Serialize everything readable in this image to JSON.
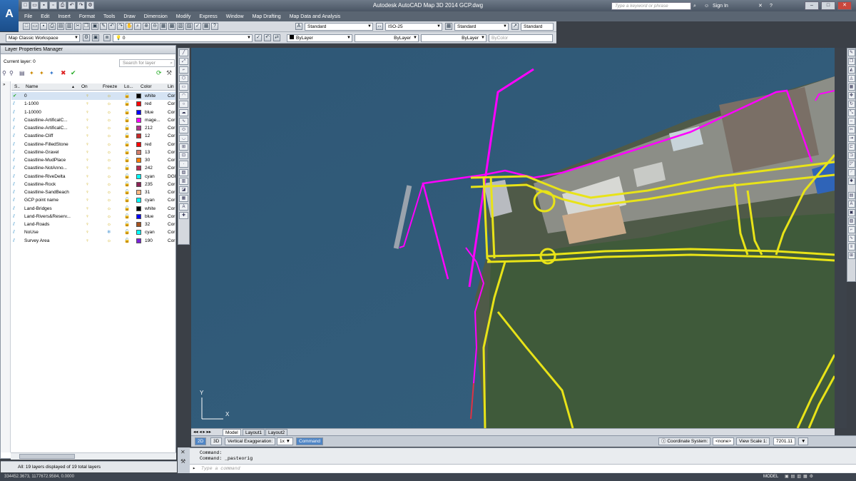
{
  "app": {
    "logo": "A",
    "title": "Autodesk AutoCAD Map 3D 2014   GCP.dwg",
    "search_placeholder": "Type a keyword or phrase",
    "sign_in": "Sign In"
  },
  "menus": [
    "File",
    "Edit",
    "Insert",
    "Format",
    "Tools",
    "Draw",
    "Dimension",
    "Modify",
    "Express",
    "Window",
    "Map Drafting",
    "Map Data and Analysis"
  ],
  "styles_toolbar": {
    "text_style": "Standard",
    "dim_style": "ISO-25",
    "table_style": "Standard",
    "mleader_style": "Standard"
  },
  "props_toolbar": {
    "workspace": "Map Classic Workspace",
    "current_layer": "0",
    "color": "ByLayer",
    "linetype": "ByLayer",
    "lineweight": "ByLayer",
    "plotstyle": "ByColor"
  },
  "layer_panel": {
    "title": "Layer Properties Manager",
    "current_layer_label": "Current layer: 0",
    "search_placeholder": "Search for layer",
    "columns": {
      "status": "S..",
      "name": "Name",
      "on": "On",
      "freeze": "Freeze",
      "lock": "Lo...",
      "color": "Color",
      "linetype": "Lin"
    },
    "status_text": "All: 19 layers displayed of 19 total layers",
    "layers": [
      {
        "name": "0",
        "color_name": "white",
        "hex": "#000000",
        "lt": "Cor",
        "frozen": false
      },
      {
        "name": "1-1000",
        "color_name": "red",
        "hex": "#ff0000",
        "lt": "Cor",
        "frozen": false
      },
      {
        "name": "1-10000",
        "color_name": "blue",
        "hex": "#0000ff",
        "lt": "Cor",
        "frozen": false
      },
      {
        "name": "Coastline-ArtificalC...",
        "color_name": "mage...",
        "hex": "#ff00ff",
        "lt": "Cor",
        "frozen": false
      },
      {
        "name": "Coastline-ArtificalC...",
        "color_name": "212",
        "hex": "#b0338f",
        "lt": "Cor",
        "frozen": false
      },
      {
        "name": "Coastline-Cliff",
        "color_name": "12",
        "hex": "#c82a2a",
        "lt": "Cor",
        "frozen": false
      },
      {
        "name": "Coastline-FilledStone",
        "color_name": "red",
        "hex": "#ff0000",
        "lt": "Cor",
        "frozen": false
      },
      {
        "name": "Coastline-Gravel",
        "color_name": "13",
        "hex": "#d27d6a",
        "lt": "Cor",
        "frozen": false
      },
      {
        "name": "Coastline-MudPlace",
        "color_name": "30",
        "hex": "#ff7f00",
        "lt": "Cor",
        "frozen": false
      },
      {
        "name": "Coastline-NotAnno...",
        "color_name": "242",
        "hex": "#b52a52",
        "lt": "Cor",
        "frozen": false
      },
      {
        "name": "Coastline-RiveDelta",
        "color_name": "cyan",
        "hex": "#00ffff",
        "lt": "DGI",
        "frozen": false
      },
      {
        "name": "Coastline-Rock",
        "color_name": "235",
        "hex": "#8a2255",
        "lt": "Cor",
        "frozen": false
      },
      {
        "name": "Coastline-SandBeach",
        "color_name": "31",
        "hex": "#ffb882",
        "lt": "Cor",
        "frozen": false
      },
      {
        "name": "GCP point name",
        "color_name": "cyan",
        "hex": "#00ffff",
        "lt": "Cor",
        "frozen": false
      },
      {
        "name": "Land-Bridges",
        "color_name": "white",
        "hex": "#000000",
        "lt": "Cor",
        "frozen": false
      },
      {
        "name": "Land-Rivers&Reserv...",
        "color_name": "blue",
        "hex": "#0000ff",
        "lt": "Cor",
        "frozen": false
      },
      {
        "name": "Land-Roads",
        "color_name": "32",
        "hex": "#a5521e",
        "lt": "Cor",
        "frozen": false
      },
      {
        "name": "NoUse",
        "color_name": "cyan",
        "hex": "#00ffff",
        "lt": "Cor",
        "frozen": true
      },
      {
        "name": "Survey Area",
        "color_name": "190",
        "hex": "#7a22d8",
        "lt": "Cor",
        "frozen": false
      }
    ]
  },
  "layout_tabs": [
    "Model",
    "Layout1",
    "Layout2"
  ],
  "status_bar": {
    "view_2d": "2D",
    "view_3d": "3D",
    "vert_exag_label": "Vertical Exaggeration:",
    "vert_exag_value": "1x",
    "command_btn": "Command",
    "coord_system_label": "Coordinate System:",
    "coord_system_value": "<none>",
    "view_scale_label": "View Scale 1:",
    "view_scale_value": "7201.11"
  },
  "command": {
    "line1": "Command:",
    "line2": "Command:  _pasteorig",
    "prompt": "Type a command"
  },
  "bottom": {
    "coords": "334452.3673, 1177672.9584, 0.0000",
    "model": "MODEL"
  },
  "ucs": {
    "x": "X",
    "y": "Y"
  }
}
